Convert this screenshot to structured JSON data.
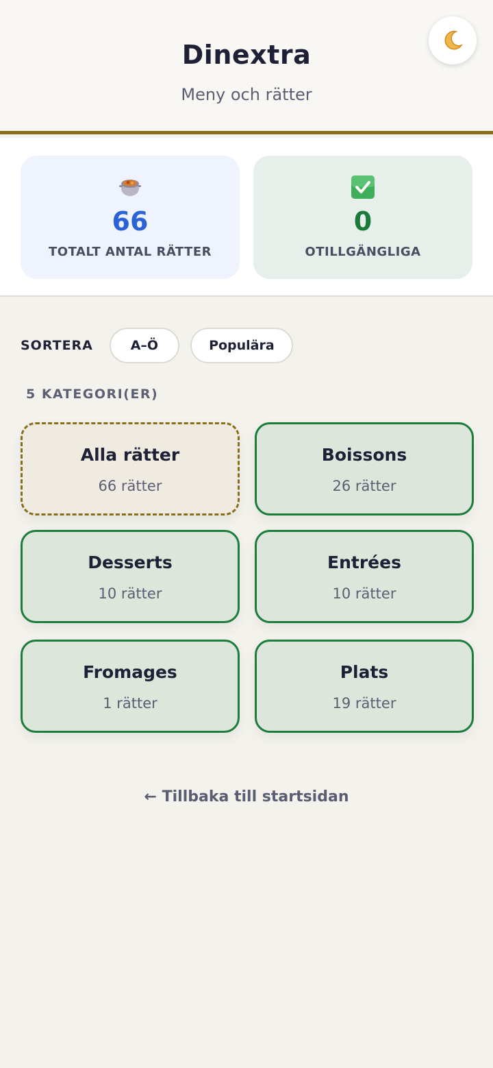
{
  "header": {
    "title": "Dinextra",
    "subtitle": "Meny och rätter",
    "theme_toggle_icon": "moon-icon"
  },
  "stats": {
    "total": {
      "icon": "cooking-pot-icon",
      "value": "66",
      "label": "TOTALT ANTAL RÄTTER"
    },
    "unavailable": {
      "icon": "check-box-icon",
      "value": "0",
      "label": "OTILLGÄNGLIGA"
    }
  },
  "sort": {
    "label": "SORTERA",
    "options": [
      "A–Ö",
      "Populära"
    ]
  },
  "categories": {
    "count_label": "5 KATEGORI(ER)",
    "items": [
      {
        "name": "Alla rätter",
        "meta": "66 rätter",
        "active": true
      },
      {
        "name": "Boissons",
        "meta": "26 rätter",
        "active": false
      },
      {
        "name": "Desserts",
        "meta": "10 rätter",
        "active": false
      },
      {
        "name": "Entrées",
        "meta": "10 rätter",
        "active": false
      },
      {
        "name": "Fromages",
        "meta": "1 rätter",
        "active": false
      },
      {
        "name": "Plats",
        "meta": "19 rätter",
        "active": false
      }
    ]
  },
  "footer": {
    "back_link": "← Tillbaka till startsidan"
  },
  "colors": {
    "accent_gold": "#8a6d1a",
    "category_border": "#1c7c3c",
    "total_value": "#2b62d6",
    "unavailable_value": "#1a7a3a"
  }
}
